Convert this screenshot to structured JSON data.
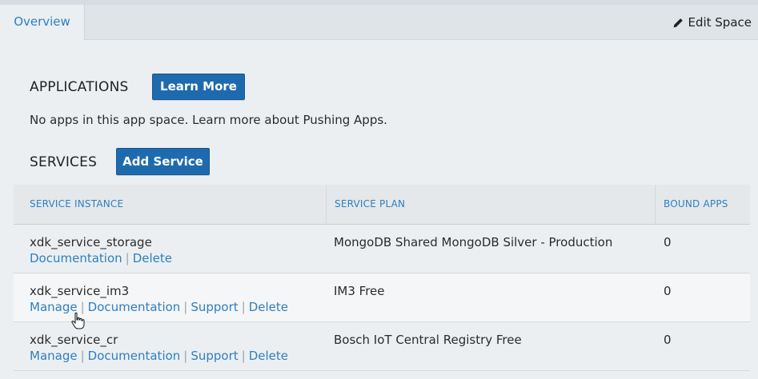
{
  "tabs": {
    "overview_label": "Overview"
  },
  "header": {
    "edit_space_label": "Edit Space",
    "edit_icon": "pencil-icon"
  },
  "applications": {
    "title": "APPLICATIONS",
    "learn_more_label": "Learn More",
    "empty_message": "No apps in this app space. Learn more about Pushing Apps."
  },
  "services": {
    "title": "SERVICES",
    "add_service_label": "Add Service",
    "columns": [
      "SERVICE INSTANCE",
      "SERVICE PLAN",
      "BOUND APPS"
    ],
    "rows": [
      {
        "name": "xdk_service_storage",
        "links": [
          "Documentation",
          "Delete"
        ],
        "plan": "MongoDB Shared MongoDB Silver - Production",
        "bound_apps": "0"
      },
      {
        "name": "xdk_service_im3",
        "links": [
          "Manage",
          "Documentation",
          "Support",
          "Delete"
        ],
        "plan": "IM3 Free",
        "bound_apps": "0"
      },
      {
        "name": "xdk_service_cr",
        "links": [
          "Manage",
          "Documentation",
          "Support",
          "Delete"
        ],
        "plan": "Bosch IoT Central Registry Free",
        "bound_apps": "0"
      }
    ]
  },
  "colors": {
    "accent": "#2d7fc1",
    "button": "#1e6aae",
    "background": "#eceff1"
  }
}
